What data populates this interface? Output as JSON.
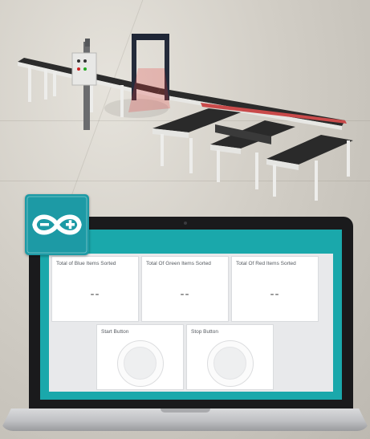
{
  "scene": {
    "description_icons": [
      "conveyor-belt",
      "control-cabinet",
      "scanner-gate",
      "sorting-lanes"
    ]
  },
  "logo": {
    "icon": "arduino-logo-icon",
    "color": "#1d9aa5"
  },
  "dashboard": {
    "accent": "#1aa8ab",
    "counters": [
      {
        "title": "Total of Blue Items Sorted",
        "value": "--"
      },
      {
        "title": "Total Of Green Items Sorted",
        "value": "--"
      },
      {
        "title": "Total Of Red Items Sorted",
        "value": "--"
      }
    ],
    "buttons": [
      {
        "title": "Start Button"
      },
      {
        "title": "Stop Button"
      }
    ]
  }
}
